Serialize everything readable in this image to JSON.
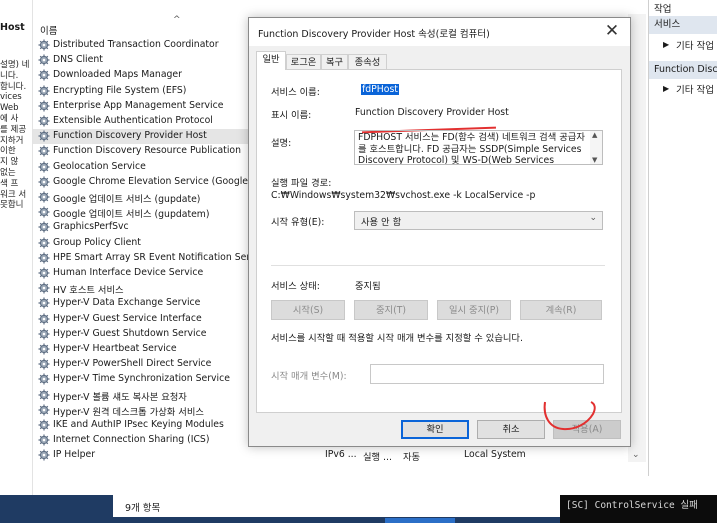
{
  "left_pane": {
    "header": "Host",
    "fragments": [
      "설명) 네",
      "니다.",
      "합니다.",
      "vices",
      "Web",
      "에 사",
      "를 제공",
      "지하거",
      "이한",
      "지 않",
      "없는",
      "색 프",
      "워크 서",
      "못합니"
    ]
  },
  "list": {
    "column_name": "이름",
    "sort_glyph": "^",
    "rows": [
      {
        "name": "Distributed Transaction Coordinator"
      },
      {
        "name": "DNS Client"
      },
      {
        "name": "Downloaded Maps Manager"
      },
      {
        "name": "Encrypting File System (EFS)"
      },
      {
        "name": "Enterprise App Management Service"
      },
      {
        "name": "Extensible Authentication Protocol"
      },
      {
        "name": "Function Discovery Provider Host",
        "selected": true
      },
      {
        "name": "Function Discovery Resource Publication"
      },
      {
        "name": "Geolocation Service"
      },
      {
        "name": "Google Chrome Elevation Service (GoogleChro"
      },
      {
        "name": "Google 업데이트 서비스 (gupdate)"
      },
      {
        "name": "Google 업데이트 서비스 (gupdatem)"
      },
      {
        "name": "GraphicsPerfSvc"
      },
      {
        "name": "Group Policy Client"
      },
      {
        "name": "HPE Smart Array SR Event Notification Service"
      },
      {
        "name": "Human Interface Device Service"
      },
      {
        "name": "HV 호스트 서비스"
      },
      {
        "name": "Hyper-V Data Exchange Service"
      },
      {
        "name": "Hyper-V Guest Service Interface"
      },
      {
        "name": "Hyper-V Guest Shutdown Service"
      },
      {
        "name": "Hyper-V Heartbeat Service"
      },
      {
        "name": "Hyper-V PowerShell Direct Service"
      },
      {
        "name": "Hyper-V Time Synchronization Service"
      },
      {
        "name": "Hyper-V 볼륨 섀도 복사본 요청자"
      },
      {
        "name": "Hyper-V 원격 데스크톱 가상화 서비스"
      },
      {
        "name": "IKE and AuthIP IPsec Keying Modules"
      },
      {
        "name": "Internet Connection Sharing (ICS)"
      },
      {
        "name": "IP Helper",
        "desc": "IPv6 ...",
        "status": "실행 ...",
        "startup": "자동",
        "logon": "Local System"
      }
    ]
  },
  "actions": {
    "top_label": "작업",
    "section1": "서비스",
    "item1": "기타 작업",
    "section2": "Function Disco",
    "item2": "기타 작업"
  },
  "status": {
    "count": "9개 항목",
    "console": "[SC] ControlService 실패"
  },
  "dialog": {
    "title": "Function Discovery Provider Host 속성(로컬 컴퓨터)",
    "tabs": [
      "일반",
      "로그온",
      "복구",
      "종속성"
    ],
    "service_name_label": "서비스 이름:",
    "service_name_value": "fdPHost",
    "display_name_label": "표시 이름:",
    "display_name_value": "Function Discovery Provider Host",
    "description_label": "설명:",
    "description_value": "FDPHOST 서비스는 FD(함수 검색) 네트워크 검색 공급자를 호스트합니다. FD 공급자는 SSDP(Simple Services Discovery Protocol) 및 WS-D(Web Services",
    "path_label": "실행 파일 경로:",
    "path_value": "C:₩Windows₩system32₩svchost.exe -k LocalService -p",
    "startup_label": "시작 유형(E):",
    "startup_value": "사용 안 함",
    "status_label": "서비스 상태:",
    "status_value": "중지됨",
    "btn_start": "시작(S)",
    "btn_stop": "중지(T)",
    "btn_pause": "일시 중지(P)",
    "btn_resume": "계속(R)",
    "hint": "서비스를 시작할 때 적용할 시작 매개 변수를 지정할 수 있습니다.",
    "param_label": "시작 매개 변수(M):",
    "param_value": "",
    "ok": "확인",
    "cancel": "취소",
    "apply": "적용(A)"
  }
}
